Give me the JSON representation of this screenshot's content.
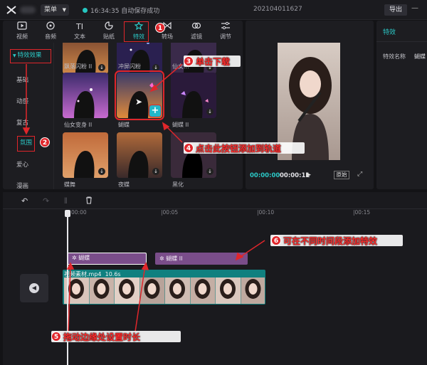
{
  "topbar": {
    "menu_label": "菜单",
    "save_status": "16:34:35 自动保存成功",
    "project_name": "202104011627",
    "export_label": "导出"
  },
  "tabs": [
    {
      "label": "视频",
      "icon": "video-icon"
    },
    {
      "label": "音频",
      "icon": "audio-icon"
    },
    {
      "label": "文本",
      "icon": "text-icon",
      "glyph": "TI"
    },
    {
      "label": "贴纸",
      "icon": "sticker-icon"
    },
    {
      "label": "特效",
      "icon": "effects-icon",
      "active": true
    },
    {
      "label": "转场",
      "icon": "transition-icon"
    },
    {
      "label": "滤镜",
      "icon": "filter-icon"
    },
    {
      "label": "调节",
      "icon": "adjust-icon"
    }
  ],
  "categories": {
    "header": "特效效果",
    "items": [
      "基础",
      "动感",
      "复古",
      "氛围",
      "爱心",
      "漫画"
    ],
    "active": "氛围"
  },
  "effects": {
    "row1": [
      "飘落闪粉 II",
      "冲屏闪粉",
      "仙女..."
    ],
    "row2": [
      "仙女变身 II",
      "蝴蝶",
      "蝴蝶 II"
    ],
    "row3": [
      "蝶舞",
      "夜蝶",
      "黑化"
    ]
  },
  "player": {
    "current_time": "00:00:00",
    "duration": "00:00:11",
    "original_label": "原始"
  },
  "inspector": {
    "title": "特效",
    "name_key": "特效名称",
    "name_value": "蝴蝶"
  },
  "timeline": {
    "ticks": [
      "00:00",
      "|00:05",
      "|00:10",
      "|00:15"
    ],
    "fx_clips": [
      "蝴蝶",
      "蝴蝶 II"
    ],
    "video_clip_label": "视频素材.mp4",
    "video_clip_duration": "10.6s"
  },
  "annotations": [
    {
      "num": "1",
      "text": ""
    },
    {
      "num": "2",
      "text": ""
    },
    {
      "num": "3",
      "text": "单击下载"
    },
    {
      "num": "4",
      "text": "点击此按钮添加到轨道"
    },
    {
      "num": "5",
      "text": "拖动边缘处设置时长"
    },
    {
      "num": "6",
      "text": "可在不同时间段添加特效"
    }
  ],
  "colors": {
    "accent": "#2bc8c6",
    "annotation": "#e0262b",
    "fx_clip": "#7a4d8a",
    "video_track": "#10807f"
  }
}
